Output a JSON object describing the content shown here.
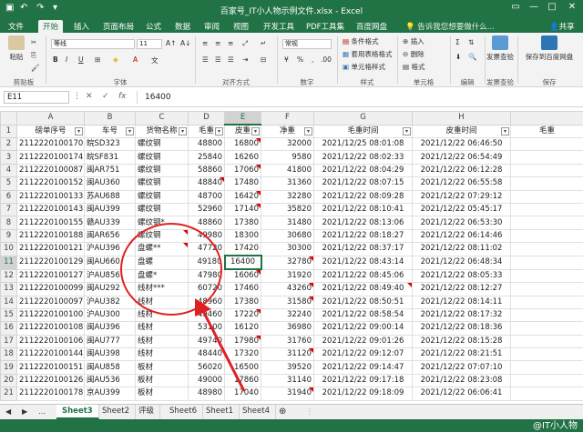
{
  "window": {
    "title": "百家号_IT小人物示例文件.xlsx - Excel"
  },
  "tabs": [
    "文件",
    "开始",
    "插入",
    "页面布局",
    "公式",
    "数据",
    "审阅",
    "视图",
    "开发工具",
    "PDF工具集",
    "百度网盘"
  ],
  "tell_me": "告诉我您想要做什么...",
  "share": "共享",
  "ribbon": {
    "paste": "粘贴",
    "clipboard": "剪贴板",
    "font_name": "等线",
    "font_size": "11",
    "font_group": "字体",
    "align_group": "对齐方式",
    "number_format": "常规",
    "number_group": "数字",
    "style_items": [
      "条件格式",
      "套用表格格式",
      "单元格样式"
    ],
    "style_group": "样式",
    "cell_items": [
      "插入",
      "删除",
      "格式"
    ],
    "cell_group": "单元格",
    "edit_group": "编辑",
    "check_button": "发票查验",
    "check_group": "发票查验",
    "save_button": "保存到百度网盘",
    "save_group": "保存"
  },
  "formula_bar": {
    "cell_ref": "E11",
    "value": "16400"
  },
  "columns": [
    "A",
    "B",
    "C",
    "D",
    "E",
    "F",
    "G",
    "H",
    ""
  ],
  "headers": [
    "磅单序号",
    "车号",
    "货物名称",
    "毛重",
    "皮重",
    "净重",
    "毛重时间",
    "皮重时间",
    "毛重"
  ],
  "rows": [
    [
      "2112220100170",
      "皖SD323",
      "螺纹钢",
      "48800",
      "16800",
      "32000",
      "2021/12/25 08:01:08",
      "2021/12/22 06:46:50"
    ],
    [
      "2112220100174",
      "皖SF831",
      "螺纹钢",
      "25840",
      "16260",
      "9580",
      "2021/12/22 08:02:33",
      "2021/12/22 06:54:49"
    ],
    [
      "2112220100087",
      "闽AR751",
      "螺纹钢",
      "58860",
      "17060",
      "41800",
      "2021/12/22 08:04:29",
      "2021/12/22 06:12:28"
    ],
    [
      "2112220100152",
      "闽AU360",
      "螺纹钢",
      "48840",
      "17480",
      "31360",
      "2021/12/22 08:07:15",
      "2021/12/22 06:55:58"
    ],
    [
      "2112220100133",
      "苏AU688",
      "螺纹钢",
      "48700",
      "16420",
      "32280",
      "2021/12/22 08:09:28",
      "2021/12/22 07:29:12"
    ],
    [
      "2112220100143",
      "闽AU399",
      "螺纹钢",
      "52960",
      "17140",
      "35820",
      "2021/12/22 08:10:41",
      "2021/12/22 05:45:17"
    ],
    [
      "2112220100155",
      "赣AU339",
      "螺纹钢*",
      "48860",
      "17380",
      "31480",
      "2021/12/22 08:13:06",
      "2021/12/22 06:53:30"
    ],
    [
      "2112220100188",
      "闽AR656",
      "螺纹钢",
      "49980",
      "18300",
      "30680",
      "2021/12/22 08:18:27",
      "2021/12/22 06:14:46"
    ],
    [
      "2112220100121",
      "沪AU396",
      "盘螺**",
      "47720",
      "17420",
      "30300",
      "2021/12/22 08:37:17",
      "2021/12/22 08:11:02"
    ],
    [
      "2112220100129",
      "闽AU660",
      "盘螺",
      "49180",
      "16400",
      "32780",
      "2021/12/22 08:43:14",
      "2021/12/22 06:48:34"
    ],
    [
      "2112220100127",
      "沪AU856",
      "盘螺*",
      "47980",
      "16060",
      "31920",
      "2021/12/22 08:45:06",
      "2021/12/22 08:05:33"
    ],
    [
      "2112220100099",
      "闽AU292",
      "线材***",
      "60720",
      "17460",
      "43260",
      "2021/12/22 08:49:40",
      "2021/12/22 08:12:27"
    ],
    [
      "2112220100097",
      "沪AU382",
      "线材",
      "48960",
      "17380",
      "31580",
      "2021/12/22 08:50:51",
      "2021/12/22 08:14:11"
    ],
    [
      "2112220100100",
      "沪AU300",
      "线材",
      "49460",
      "17220",
      "32240",
      "2021/12/22 08:58:54",
      "2021/12/22 08:17:32"
    ],
    [
      "2112220100108",
      "闽AU396",
      "线材",
      "53100",
      "16120",
      "36980",
      "2021/12/22 09:00:14",
      "2021/12/22 08:18:36"
    ],
    [
      "2112220100106",
      "闽AU777",
      "线材",
      "49740",
      "17980",
      "31760",
      "2021/12/22 09:01:26",
      "2021/12/22 08:15:28"
    ],
    [
      "2112220100144",
      "闽AU398",
      "线材",
      "48440",
      "17320",
      "31120",
      "2021/12/22 09:12:07",
      "2021/12/22 08:21:51"
    ],
    [
      "2112220100151",
      "闽AU858",
      "板材",
      "56020",
      "16500",
      "39520",
      "2021/12/22 09:14:47",
      "2021/12/22 07:07:10"
    ],
    [
      "2112220100126",
      "闽AU536",
      "板材",
      "49000",
      "17860",
      "31140",
      "2021/12/22 09:17:18",
      "2021/12/22 08:23:08"
    ],
    [
      "2112220100178",
      "京AU399",
      "板材",
      "48980",
      "17040",
      "31940",
      "2021/12/22 09:18:09",
      "2021/12/22 06:06:41"
    ]
  ],
  "sheets": [
    "Sheet3",
    "Sheet2",
    "评级",
    "Sheet6",
    "Sheet1",
    "Sheet4"
  ],
  "active_sheet": "Sheet3",
  "watermark": "@IT小人物"
}
